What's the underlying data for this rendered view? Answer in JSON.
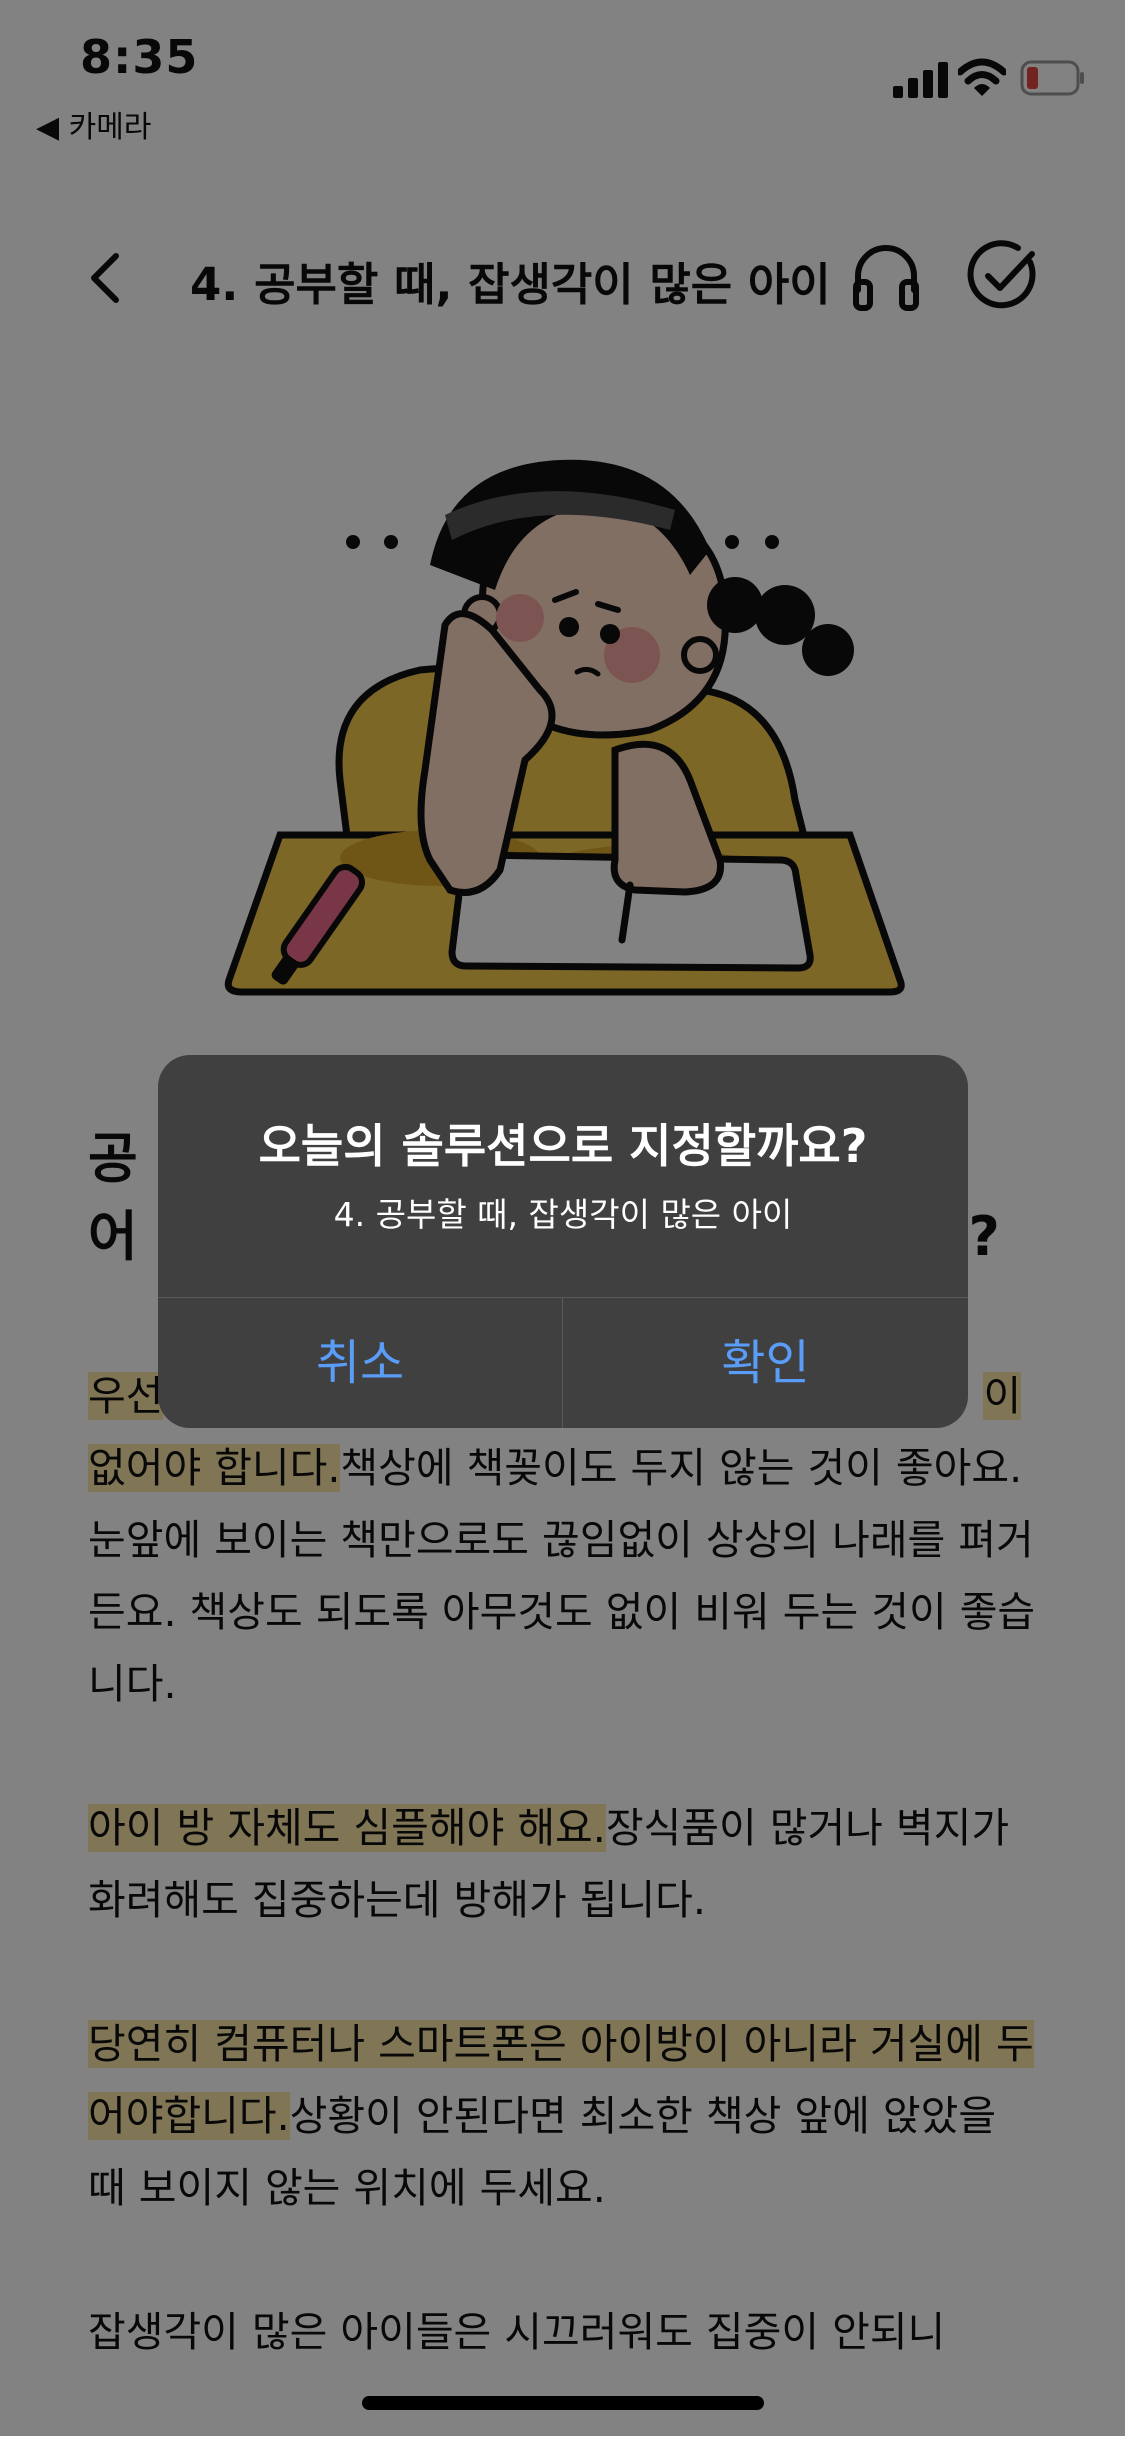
{
  "status_bar": {
    "time": "8:35",
    "back_app": "◀ 카메라",
    "icons": [
      "signal-icon",
      "wifi-icon",
      "battery-low-icon"
    ],
    "battery_color": "#e2473f"
  },
  "nav": {
    "title": "4. 공부할 때, 잡생각이 많은 아이",
    "icons": [
      "back-chevron-icon",
      "headphones-icon",
      "checkmark-circle-icon"
    ]
  },
  "article": {
    "heading_line1": "공",
    "heading_line2": "어",
    "heading_tail": ".?",
    "paragraphs": [
      {
        "highlight": "우선",
        "tail_highlight": "이",
        "line2_highlight": "없어야 합니다.",
        "text": "책상에 책꽂이도 두지 않는 것이 좋아요. 눈앞에 보이는 책만으로도 끊임없이 상상의 나래를 펴거든요. 책상도 되도록 아무것도 없이 비워 두는 것이 좋습니다."
      },
      {
        "highlight": "아이 방 자체도 심플해야 해요.",
        "text": "장식품이 많거나 벽지가 화려해도 집중하는데 방해가 됩니다."
      },
      {
        "highlight": "당연히 컴퓨터나 스마트폰은 아이방이 아니라 거실에 두어야합니다.",
        "text": "상황이 안된다면 최소한 책상 앞에 앉았을 때 보이지 않는 위치에 두세요."
      },
      {
        "highlight": "",
        "text": "잡생각이 많은 아이들은 시끄러워도 집중이 안되니"
      }
    ],
    "highlight_color": "#fce8a8"
  },
  "dialog": {
    "title": "오늘의 솔루션으로 지정할까요?",
    "message": "4. 공부할 때, 잡생각이 많은 아이",
    "cancel_label": "취소",
    "confirm_label": "확인",
    "button_color": "#5a9df8"
  }
}
